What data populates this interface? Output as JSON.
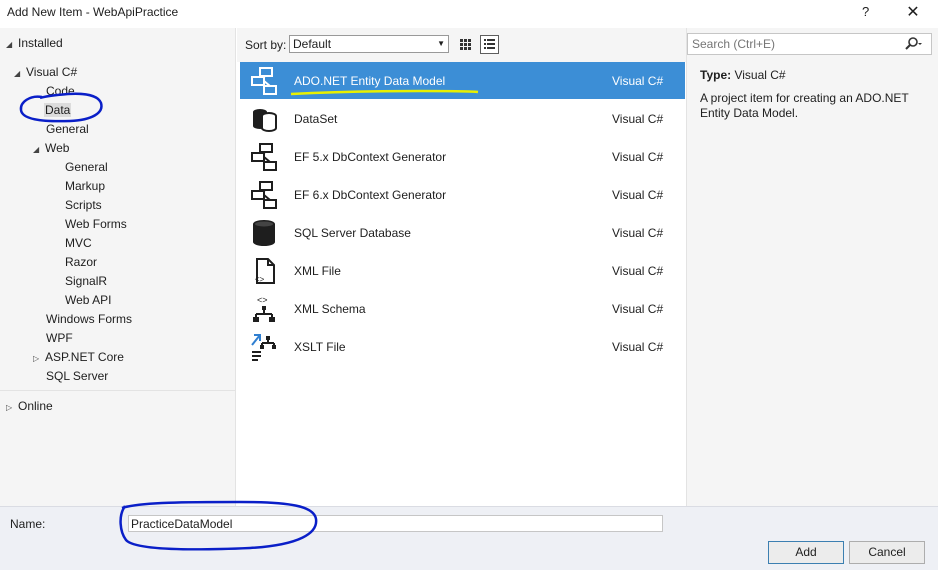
{
  "window": {
    "title": "Add New Item - WebApiPractice",
    "help_label": "?",
    "close_label": "✕"
  },
  "tree": {
    "installed": "Installed",
    "visual_csharp": "Visual C#",
    "code": "Code",
    "data": "Data",
    "general": "General",
    "web": "Web",
    "web_children": [
      "General",
      "Markup",
      "Scripts",
      "Web Forms",
      "MVC",
      "Razor",
      "SignalR",
      "Web API"
    ],
    "windows_forms": "Windows Forms",
    "wpf": "WPF",
    "aspnet_core": "ASP.NET Core",
    "sql_server": "SQL Server",
    "online": "Online",
    "expanded_glyph": "◢",
    "collapsed_glyph": "▷"
  },
  "toolbar": {
    "sort_label": "Sort by:",
    "sort_value": "Default",
    "dropdown_arrow": "▼"
  },
  "items": [
    {
      "name": "ADO.NET Entity Data Model",
      "lang": "Visual C#",
      "icon": "entity-model-icon",
      "selected": true
    },
    {
      "name": "DataSet",
      "lang": "Visual C#",
      "icon": "dataset-icon"
    },
    {
      "name": "EF 5.x DbContext Generator",
      "lang": "Visual C#",
      "icon": "ef5-generator-icon"
    },
    {
      "name": "EF 6.x DbContext Generator",
      "lang": "Visual C#",
      "icon": "ef6-generator-icon"
    },
    {
      "name": "SQL Server Database",
      "lang": "Visual C#",
      "icon": "database-icon"
    },
    {
      "name": "XML File",
      "lang": "Visual C#",
      "icon": "xml-file-icon"
    },
    {
      "name": "XML Schema",
      "lang": "Visual C#",
      "icon": "xml-schema-icon"
    },
    {
      "name": "XSLT File",
      "lang": "Visual C#",
      "icon": "xslt-file-icon"
    }
  ],
  "details": {
    "search_placeholder": "Search (Ctrl+E)",
    "type_label": "Type:",
    "type_value": "Visual C#",
    "description": "A project item for creating an ADO.NET Entity Data Model."
  },
  "footer": {
    "name_label": "Name:",
    "name_value": "PracticeDataModel",
    "add_label": "Add",
    "cancel_label": "Cancel"
  },
  "colors": {
    "selection": "#3c8ed6",
    "annotation_blue": "#0a1fc8",
    "annotation_yellow": "#e8f000",
    "icon_dark": "#1e1e1e",
    "icon_blue": "#2f7fd1"
  }
}
